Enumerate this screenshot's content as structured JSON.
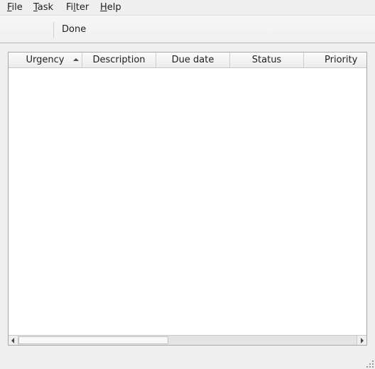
{
  "menubar": {
    "items": [
      {
        "mnemonic": "F",
        "rest": "ile"
      },
      {
        "mnemonic": "T",
        "rest": "ask"
      },
      {
        "prefix": "Fi",
        "mnemonic": "l",
        "rest": "ter"
      },
      {
        "mnemonic": "H",
        "rest": "elp"
      }
    ]
  },
  "toolbar": {
    "done_label": "Done"
  },
  "table": {
    "columns": [
      {
        "label": "Urgency",
        "sorted": "ascending"
      },
      {
        "label": "Description"
      },
      {
        "label": "Due date"
      },
      {
        "label": "Status"
      },
      {
        "label": "Priority"
      }
    ],
    "rows": []
  }
}
